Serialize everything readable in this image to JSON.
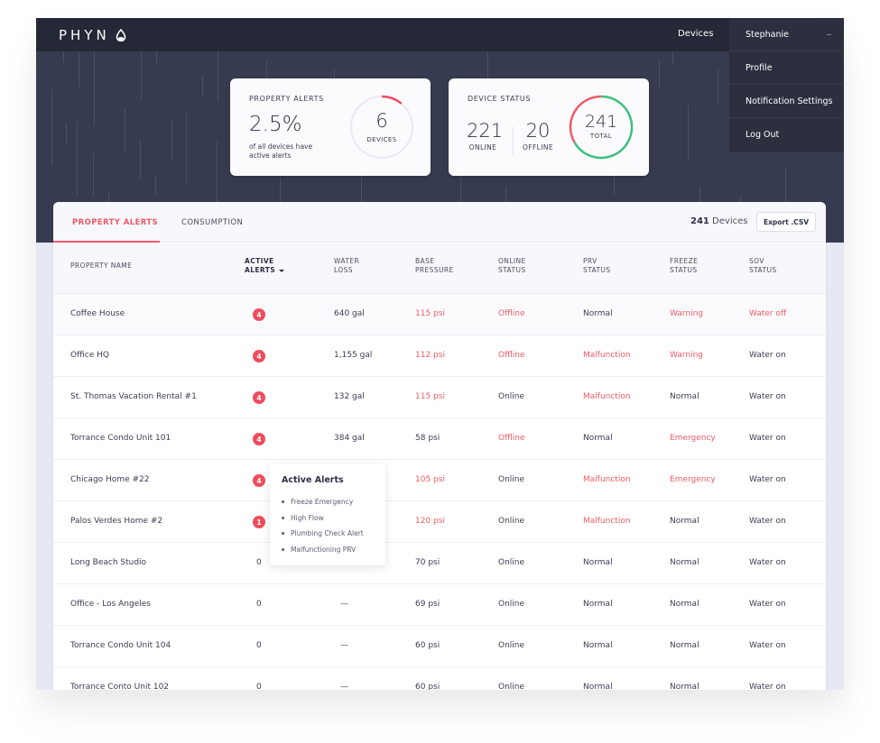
{
  "navbar": {
    "logo_text": "PHYN",
    "devices_link": "Devices",
    "user_name": "Stephanie",
    "user_menu": [
      "Profile",
      "Notification Settings",
      "Log Out"
    ]
  },
  "property_alerts_card": {
    "title": "PROPERTY ALERTS",
    "percent": "2.5%",
    "subtitle": "of all devices have active alerts",
    "ring_value": "6",
    "ring_label": "DEVICES",
    "ring_fraction": 0.1
  },
  "device_status_card": {
    "title": "DEVICE STATUS",
    "online_value": "221",
    "online_label": "ONLINE",
    "offline_value": "20",
    "offline_label": "OFFLINE",
    "total_value": "241",
    "total_label": "TOTAL"
  },
  "colors": {
    "accent": "#ef5a67",
    "online_green": "#3fbf7f",
    "navbar": "#252836",
    "hero": "#373b4f"
  },
  "panel": {
    "tabs": [
      "PROPERTY ALERTS",
      "CONSUMPTION"
    ],
    "active_tab": "PROPERTY ALERTS",
    "device_count_num": "241",
    "device_count_suffix": " Devices",
    "export_label": "Export .CSV"
  },
  "table": {
    "columns": [
      {
        "line1": "PROPERTY NAME",
        "line2": ""
      },
      {
        "line1": "ACTIVE",
        "line2": "ALERTS"
      },
      {
        "line1": "WATER",
        "line2": "LOSS"
      },
      {
        "line1": "BASE",
        "line2": "PRESSURE"
      },
      {
        "line1": "ONLINE",
        "line2": "STATUS"
      },
      {
        "line1": "PRV",
        "line2": "STATUS"
      },
      {
        "line1": "FREEZE",
        "line2": "STATUS"
      },
      {
        "line1": "SOV",
        "line2": "STATUS"
      }
    ],
    "rows": [
      {
        "name": "Coffee House",
        "alerts": "4",
        "water_loss": "640 gal",
        "pressure": "115 psi",
        "online": "Offline",
        "prv": "Normal",
        "freeze": "Warning",
        "sov": "Water off"
      },
      {
        "name": "Office HQ",
        "alerts": "4",
        "water_loss": "1,155 gal",
        "pressure": "112 psi",
        "online": "Offline",
        "prv": "Malfunction",
        "freeze": "Warning",
        "sov": "Water on"
      },
      {
        "name": "St. Thomas Vacation Rental #1",
        "alerts": "4",
        "water_loss": "132 gal",
        "pressure": "115 psi",
        "online": "Online",
        "prv": "Malfunction",
        "freeze": "Normal",
        "sov": "Water on"
      },
      {
        "name": "Torrance Condo Unit 101",
        "alerts": "4",
        "water_loss": "384 gal",
        "pressure": "58 psi",
        "online": "Offline",
        "prv": "Normal",
        "freeze": "Emergency",
        "sov": "Water on"
      },
      {
        "name": "Chicago Home #22",
        "alerts": "4",
        "water_loss": "",
        "pressure": "105 psi",
        "online": "Online",
        "prv": "Malfunction",
        "freeze": "Emergency",
        "sov": "Water on"
      },
      {
        "name": "Palos Verdes Home #2",
        "alerts": "1",
        "water_loss": "",
        "pressure": "120 psi",
        "online": "Online",
        "prv": "Malfunction",
        "freeze": "Normal",
        "sov": "Water on"
      },
      {
        "name": "Long Beach Studio",
        "alerts": "0",
        "water_loss": "",
        "pressure": "70 psi",
        "online": "Online",
        "prv": "Normal",
        "freeze": "Normal",
        "sov": "Water on"
      },
      {
        "name": "Office - Los Angeles",
        "alerts": "0",
        "water_loss": "—",
        "pressure": "69 psi",
        "online": "Online",
        "prv": "Normal",
        "freeze": "Normal",
        "sov": "Water on"
      },
      {
        "name": "Torrance Condo Unit 104",
        "alerts": "0",
        "water_loss": "—",
        "pressure": "60 psi",
        "online": "Online",
        "prv": "Normal",
        "freeze": "Normal",
        "sov": "Water on"
      },
      {
        "name": "Torrance Conto Unit 102",
        "alerts": "0",
        "water_loss": "—",
        "pressure": "60 psi",
        "online": "Online",
        "prv": "Normal",
        "freeze": "Normal",
        "sov": "Water on"
      }
    ],
    "alert_flags": [
      {
        "pressure": true,
        "online": true,
        "prv": false,
        "freeze": true,
        "sov": true
      },
      {
        "pressure": true,
        "online": true,
        "prv": true,
        "freeze": true,
        "sov": false
      },
      {
        "pressure": true,
        "online": false,
        "prv": true,
        "freeze": false,
        "sov": false
      },
      {
        "pressure": false,
        "online": true,
        "prv": false,
        "freeze": true,
        "sov": false
      },
      {
        "pressure": true,
        "online": false,
        "prv": true,
        "freeze": true,
        "sov": false
      },
      {
        "pressure": true,
        "online": false,
        "prv": true,
        "freeze": false,
        "sov": false
      },
      {
        "pressure": false,
        "online": false,
        "prv": false,
        "freeze": false,
        "sov": false
      },
      {
        "pressure": false,
        "online": false,
        "prv": false,
        "freeze": false,
        "sov": false
      },
      {
        "pressure": false,
        "online": false,
        "prv": false,
        "freeze": false,
        "sov": false
      },
      {
        "pressure": false,
        "online": false,
        "prv": false,
        "freeze": false,
        "sov": false
      }
    ]
  },
  "tooltip": {
    "title": "Active Alerts",
    "items": [
      "Freeze Emergency",
      "High Flow",
      "Plumbing Check Alert",
      "Malfunctioning PRV"
    ]
  }
}
